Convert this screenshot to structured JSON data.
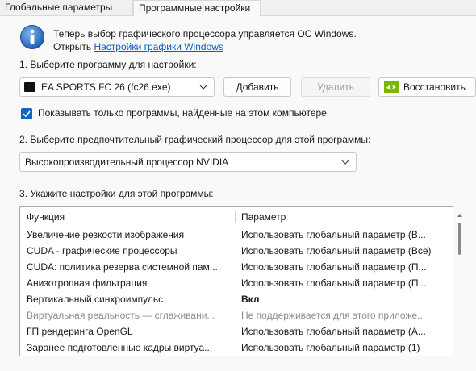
{
  "tabs": [
    {
      "label": "Глобальные параметры",
      "active": false
    },
    {
      "label": "Программные настройки",
      "active": true
    }
  ],
  "info": {
    "line1": "Теперь выбор графического процессора управляется ОС Windows.",
    "line2_prefix": "Открыть ",
    "link_label": "Настройки графики Windows",
    "icon": "info-icon"
  },
  "step1": {
    "label": "1. Выберите программу для настройки:",
    "selected_program": "EA SPORTS FC 26 (fc26.exe)",
    "add_label": "Добавить",
    "remove_label": "Удалить",
    "restore_label": "Восстановить"
  },
  "filter": {
    "label": "Показывать только программы, найденные на этом компьютере",
    "checked": true
  },
  "step2": {
    "label": "2. Выберите предпочтительный графический процессор для этой программы:",
    "selected_gpu": "Высокопроизводительный процессор NVIDIA"
  },
  "step3": {
    "label": "3. Укажите настройки для этой программы:",
    "columns": [
      "Функция",
      "Параметр"
    ],
    "rows": [
      {
        "feature": "Увеличение резкости изображения",
        "value": "Использовать глобальный параметр (В...",
        "dim": false,
        "bold": false
      },
      {
        "feature": "CUDA - графические процессоры",
        "value": "Использовать глобальный параметр (Все)",
        "dim": false,
        "bold": false
      },
      {
        "feature": "CUDA: политика резерва системной пам...",
        "value": "Использовать глобальный параметр (П...",
        "dim": false,
        "bold": false
      },
      {
        "feature": "Анизотропная фильтрация",
        "value": "Использовать глобальный параметр (П...",
        "dim": false,
        "bold": false
      },
      {
        "feature": "Вертикальный синхроимпульс",
        "value": "Вкл",
        "dim": false,
        "bold": true
      },
      {
        "feature": "Виртуальная реальность — сглаживани...",
        "value": "Не поддерживается для этого приложе...",
        "dim": true,
        "bold": false
      },
      {
        "feature": "ГП рендеринга OpenGL",
        "value": "Использовать глобальный параметр (А...",
        "dim": false,
        "bold": false
      },
      {
        "feature": "Заранее подготовленные кадры виртуа...",
        "value": "Использовать глобальный параметр (1)",
        "dim": false,
        "bold": false
      }
    ]
  },
  "colors": {
    "link": "#0b5ec4",
    "checkbox": "#1565c0",
    "nvidia_green": "#76b900"
  }
}
